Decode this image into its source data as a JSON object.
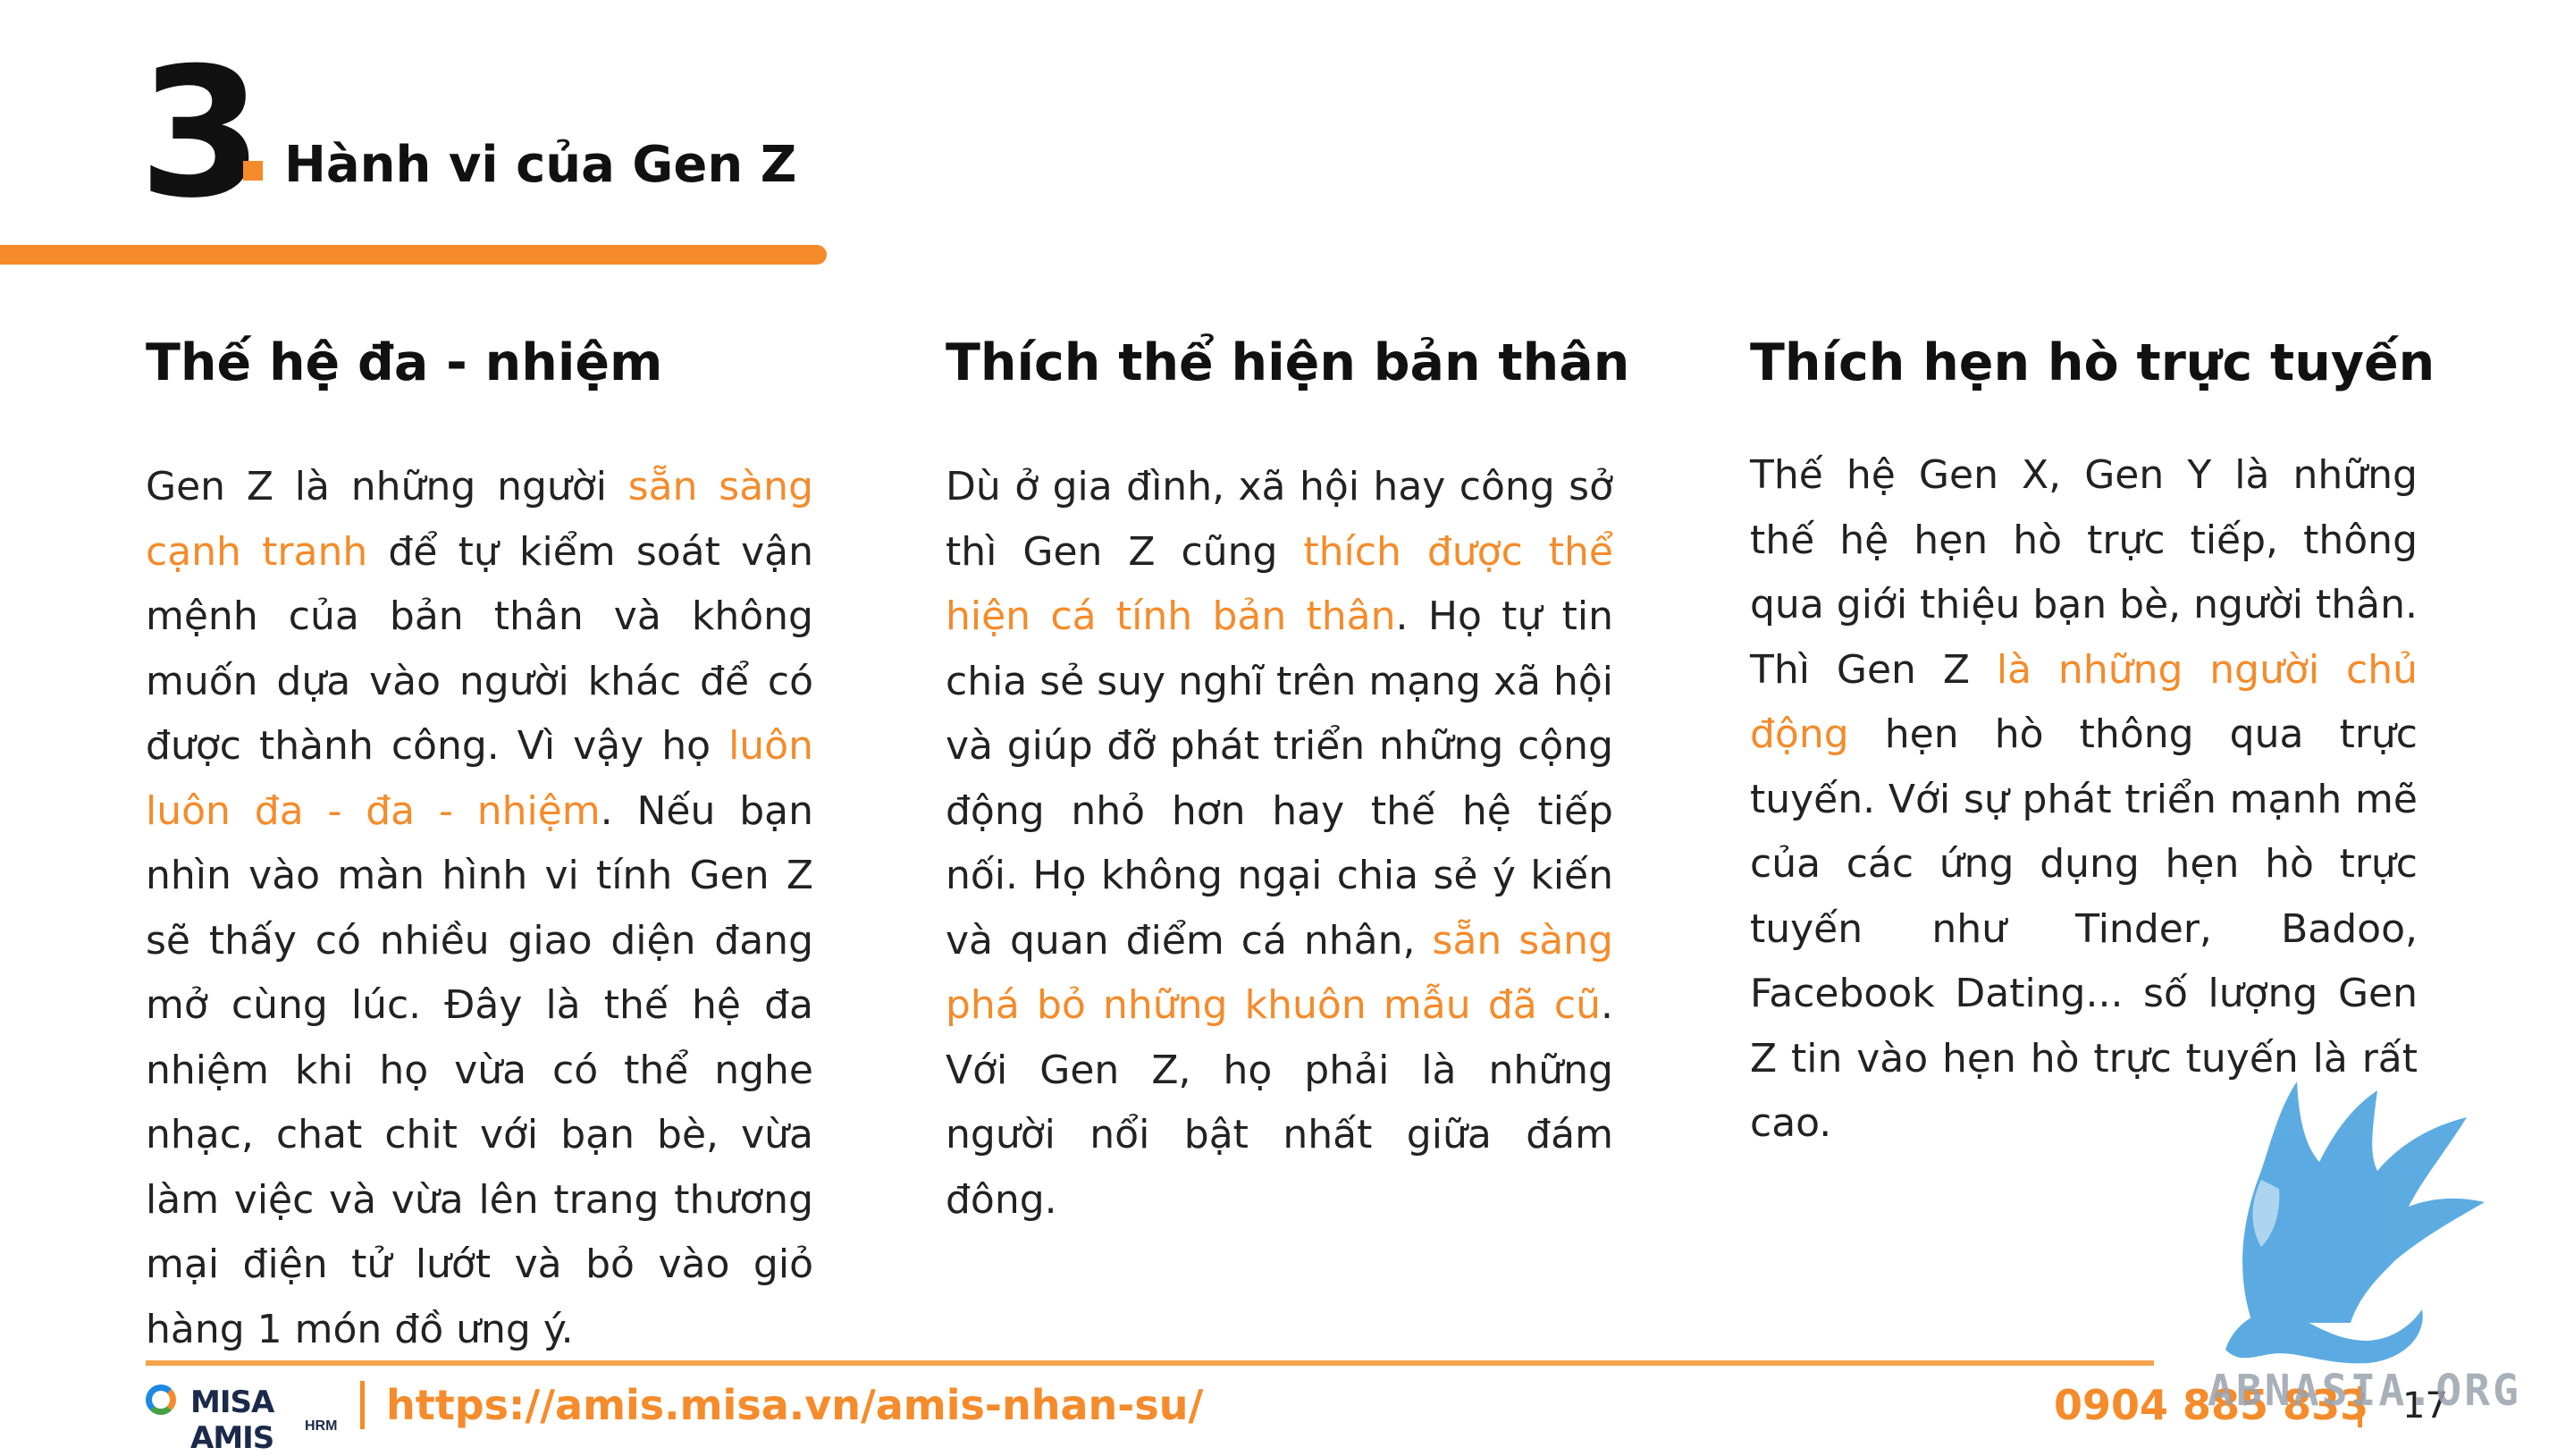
{
  "header": {
    "number": "3",
    "title": "Hành vi của Gen Z"
  },
  "columns": [
    {
      "heading": "Thế hệ đa - nhiệm",
      "segments": [
        {
          "text": "Gen Z là những người ",
          "highlight": false
        },
        {
          "text": "sẵn sàng cạnh tranh",
          "highlight": true
        },
        {
          "text": " để tự kiểm soát vận mệnh của bản thân và không muốn dựa vào người khác để có được thành công. Vì vậy họ ",
          "highlight": false
        },
        {
          "text": "luôn luôn đa - đa - nhiệm",
          "highlight": true
        },
        {
          "text": ". Nếu bạn nhìn vào màn hình vi tính Gen Z sẽ thấy có nhiều giao diện đang mở cùng lúc. Đây là thế hệ đa nhiệm khi họ vừa có thể nghe nhạc, chat chit với bạn bè, vừa làm việc và vừa lên trang thương mại điện tử  lướt và bỏ vào giỏ hàng 1 món đồ ưng ý.",
          "highlight": false
        }
      ]
    },
    {
      "heading": "Thích thể hiện bản thân",
      "segments": [
        {
          "text": "Dù ở gia đình, xã hội hay công sở thì Gen Z cũng ",
          "highlight": false
        },
        {
          "text": "thích được thể hiện cá tính bản thân",
          "highlight": true
        },
        {
          "text": ". Họ tự tin chia sẻ suy nghĩ trên mạng xã hội và giúp đỡ phát triển những cộng động nhỏ hơn hay thế hệ tiếp nối. Họ không ngại chia sẻ ý kiến và quan điểm cá nhân, ",
          "highlight": false
        },
        {
          "text": "sẵn sàng phá bỏ những khuôn mẫu đã cũ",
          "highlight": true
        },
        {
          "text": ". Với Gen Z, họ phải là những người nổi bật nhất giữa đám đông.",
          "highlight": false
        }
      ]
    },
    {
      "heading": "Thích hẹn hò trực tuyến",
      "segments": [
        {
          "text": "Thế hệ Gen X, Gen Y là những thế hệ hẹn hò trực tiếp, thông qua giới thiệu bạn bè, người thân. Thì Gen Z ",
          "highlight": false
        },
        {
          "text": "là những người chủ động",
          "highlight": true
        },
        {
          "text": " hẹn hò thông qua trực tuyến. Với sự phát triển mạnh mẽ của các ứng dụng hẹn hò trực tuyến như Tinder, Badoo, Facebook Dating... số lượng Gen Z tin vào hẹn hò trực tuyến là rất cao.",
          "highlight": false
        }
      ]
    }
  ],
  "footer": {
    "logo_text": "MISA AMIS",
    "logo_sub": "HRM",
    "url": "https://amis.misa.vn/amis-nhan-su/",
    "phone": "0904 885 833",
    "page_number": "17"
  },
  "watermark": {
    "text": "ABNASIA.ORG"
  },
  "colors": {
    "accent": "#f58b2a",
    "text": "#222222",
    "watermark_blue": "#4aa3df"
  }
}
